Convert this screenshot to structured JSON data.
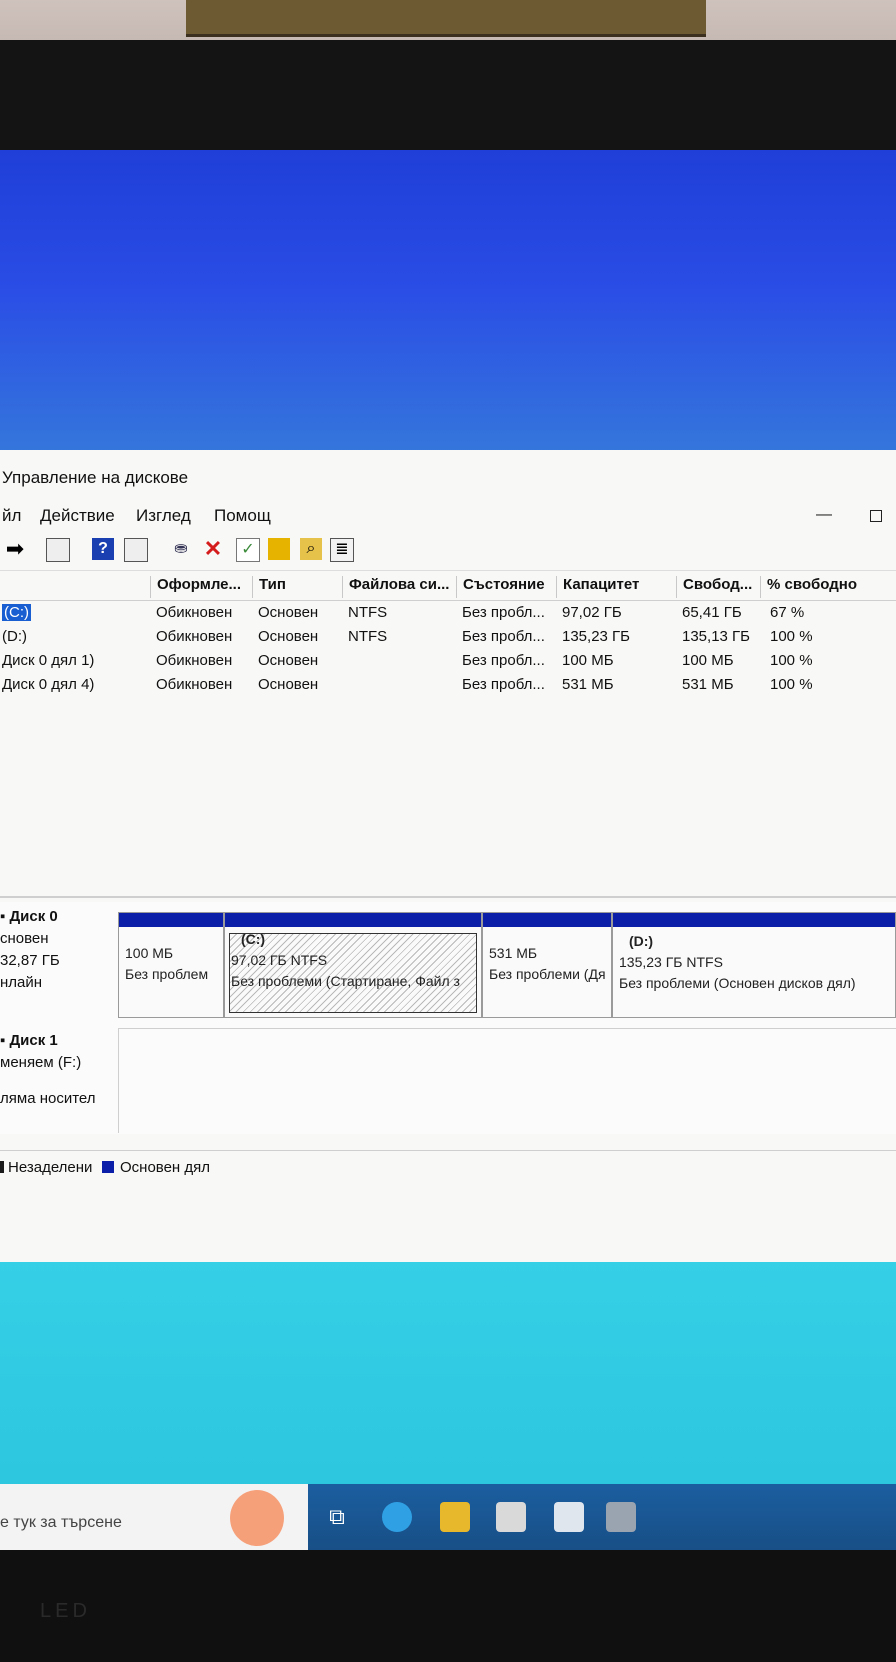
{
  "window": {
    "title": "Управление на дискове"
  },
  "menu": [
    "йл",
    "Действие",
    "Изглед",
    "Помощ"
  ],
  "table": {
    "columns": [
      "",
      "Оформле...",
      "Тип",
      "Файлова си...",
      "Състояние",
      "Капацитет",
      "Свобод...",
      "% свободно"
    ],
    "rows": [
      [
        "(C:)",
        "Обикновен",
        "Основен",
        "NTFS",
        "Без пробл...",
        "97,02 ГБ",
        "65,41 ГБ",
        "67 %"
      ],
      [
        "(D:)",
        "Обикновен",
        "Основен",
        "NTFS",
        "Без пробл...",
        "135,23 ГБ",
        "135,13 ГБ",
        "100 %"
      ],
      [
        "Диск 0 дял 1)",
        "Обикновен",
        "Основен",
        "",
        "Без пробл...",
        "100 МБ",
        "100 МБ",
        "100 %"
      ],
      [
        "Диск 0 дял 4)",
        "Обикновен",
        "Основен",
        "",
        "Без пробл...",
        "531 МБ",
        "531 МБ",
        "100 %"
      ]
    ]
  },
  "disks": {
    "disk0": {
      "name": "Диск 0",
      "type": "сновен",
      "size": "32,87 ГБ",
      "status": "нлайн"
    },
    "disk1": {
      "name": "Диск 1",
      "type": "меняем (F:)",
      "status": "ляма носител"
    }
  },
  "partitions": [
    {
      "letter": "",
      "size": "100 МБ",
      "status": "Без проблем"
    },
    {
      "letter": "(C:)",
      "size": "97,02 ГБ NTFS",
      "status": "Без проблеми (Стартиране, Файл з"
    },
    {
      "letter": "",
      "size": "531 МБ",
      "status": "Без проблеми (Дя"
    },
    {
      "letter": "(D:)",
      "size": "135,23 ГБ NTFS",
      "status": "Без проблеми (Основен дисков дял)"
    }
  ],
  "legend": {
    "unallocated": "Незаделени",
    "primary": "Основен дял",
    "unallocated_color": "#1a1a1a",
    "primary_color": "#0a1ea8"
  },
  "taskbar": {
    "search_placeholder": "е тук за търсене"
  },
  "monitor": {
    "brand": "LED"
  }
}
